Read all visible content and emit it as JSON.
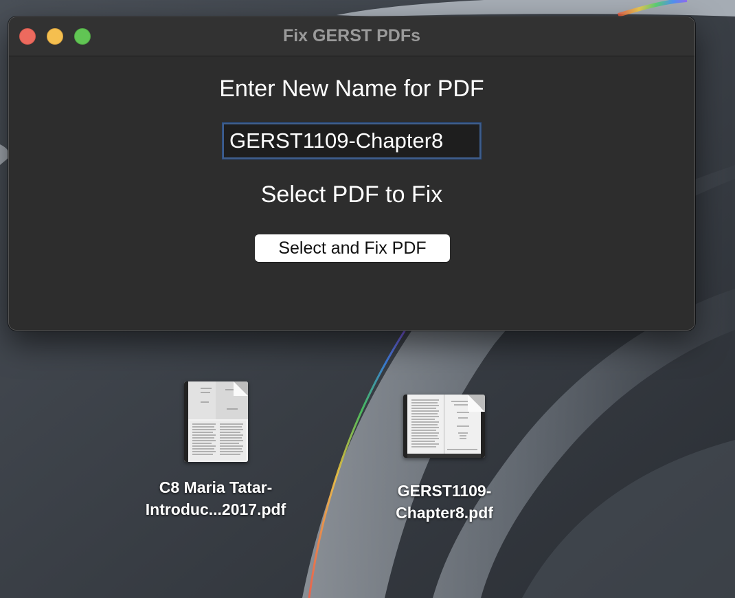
{
  "window": {
    "title": "Fix GERST PDFs"
  },
  "form": {
    "name_heading": "Enter New Name for PDF",
    "name_value": "GERST1109-Chapter8",
    "select_heading": "Select PDF to Fix",
    "fix_button_label": "Select and Fix PDF"
  },
  "desktop": {
    "files": [
      {
        "line1": "C8 Maria Tatar-",
        "line2": "Introduc...2017.pdf",
        "icon": "pdf-document-icon"
      },
      {
        "line1": "GERST1109-",
        "line2": "Chapter8.pdf",
        "icon": "pdf-document-icon"
      }
    ]
  },
  "colors": {
    "close": "#ed6a5e",
    "minimize": "#f5bf4f",
    "zoom": "#61c554",
    "input_focus_ring": "#3f5e8c"
  }
}
